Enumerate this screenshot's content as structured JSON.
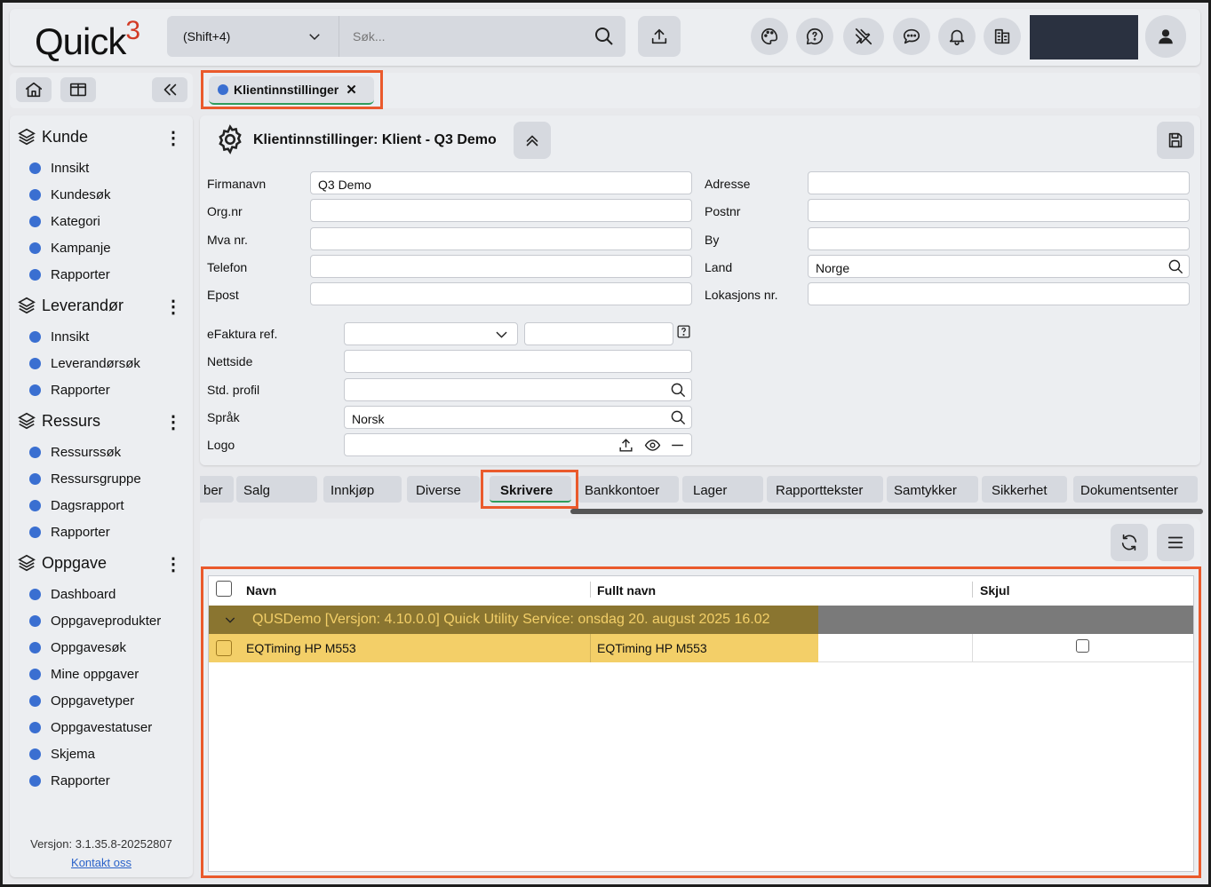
{
  "app": {
    "logo_text": "Quick",
    "logo_sup": "3"
  },
  "search": {
    "scope": "(Shift+4)",
    "placeholder": "Søk..."
  },
  "nav": {
    "groups": [
      {
        "label": "Kunde",
        "items": [
          "Innsikt",
          "Kundesøk",
          "Kategori",
          "Kampanje",
          "Rapporter"
        ]
      },
      {
        "label": "Leverandør",
        "items": [
          "Innsikt",
          "Leverandørsøk",
          "Rapporter"
        ]
      },
      {
        "label": "Ressurs",
        "items": [
          "Ressurssøk",
          "Ressursgruppe",
          "Dagsrapport",
          "Rapporter"
        ]
      },
      {
        "label": "Oppgave",
        "items": [
          "Dashboard",
          "Oppgaveprodukter",
          "Oppgavesøk",
          "Mine oppgaver",
          "Oppgavetyper",
          "Oppgavestatuser",
          "Skjema",
          "Rapporter"
        ]
      }
    ],
    "version": "Versjon: 3.1.35.8-20252807",
    "contact": "Kontakt oss"
  },
  "doc_tab": {
    "label": "Klientinnstillinger",
    "close": "✕"
  },
  "panel": {
    "title": "Klientinnstillinger: Klient - Q3 Demo",
    "left_labels": [
      "Firmanavn",
      "Org.nr",
      "Mva nr.",
      "Telefon",
      "Epost"
    ],
    "left_values": [
      "Q3 Demo",
      "",
      "",
      "",
      ""
    ],
    "right_labels": [
      "Adresse",
      "Postnr",
      "By",
      "Land",
      "Lokasjons nr."
    ],
    "right_values": [
      "",
      "",
      "",
      "Norge",
      ""
    ],
    "extra_labels": [
      "eFaktura ref.",
      "Nettside",
      "Std. profil",
      "Språk",
      "Logo"
    ],
    "sprak_value": "Norsk"
  },
  "sub_tabs": [
    "ber",
    "Salg",
    "Innkjøp",
    "Diverse",
    "Skrivere",
    "Bankkontoer",
    "Lager",
    "Rapporttekster",
    "Samtykker",
    "Sikkerhet",
    "Dokumentsenter"
  ],
  "active_sub_tab": "Skrivere",
  "grid": {
    "columns": [
      "Navn",
      "Fullt navn",
      "Skjul"
    ],
    "group_label": "QUSDemo [Versjon: 4.10.0.0] Quick Utility Service: onsdag 20. august 2025 16.02",
    "rows": [
      {
        "navn": "EQTiming HP M553",
        "fullt_navn": "EQTiming HP M553",
        "skjul": false
      }
    ]
  }
}
